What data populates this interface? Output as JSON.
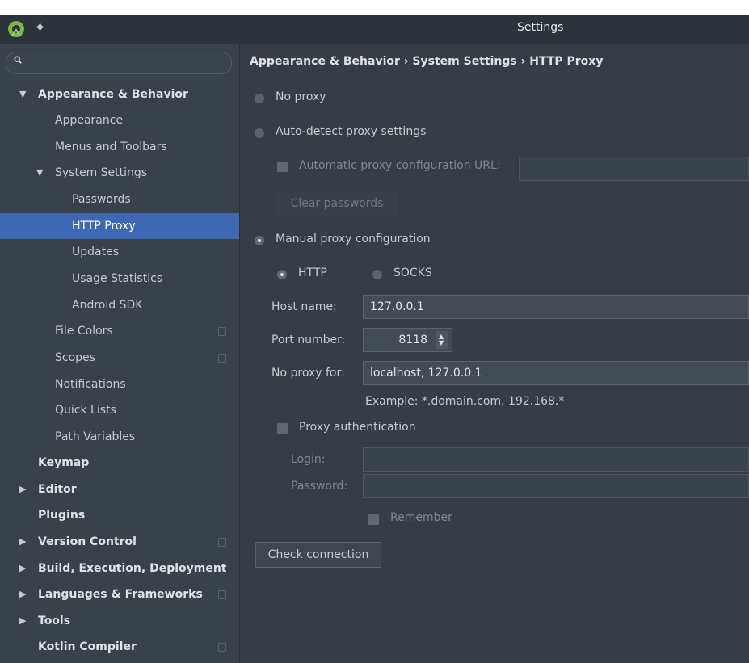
{
  "window": {
    "title": "Settings"
  },
  "search": {
    "placeholder": ""
  },
  "sidebar": {
    "items": [
      {
        "label": "Appearance & Behavior",
        "arrow": "▼"
      },
      {
        "label": "Appearance"
      },
      {
        "label": "Menus and Toolbars"
      },
      {
        "label": "System Settings",
        "arrow": "▼"
      },
      {
        "label": "Passwords"
      },
      {
        "label": "HTTP Proxy"
      },
      {
        "label": "Updates"
      },
      {
        "label": "Usage Statistics"
      },
      {
        "label": "Android SDK"
      },
      {
        "label": "File Colors"
      },
      {
        "label": "Scopes"
      },
      {
        "label": "Notifications"
      },
      {
        "label": "Quick Lists"
      },
      {
        "label": "Path Variables"
      },
      {
        "label": "Keymap"
      },
      {
        "label": "Editor",
        "arrow": "▶"
      },
      {
        "label": "Plugins"
      },
      {
        "label": "Version Control",
        "arrow": "▶"
      },
      {
        "label": "Build, Execution, Deployment",
        "arrow": "▶"
      },
      {
        "label": "Languages & Frameworks",
        "arrow": "▶"
      },
      {
        "label": "Tools",
        "arrow": "▶"
      },
      {
        "label": "Kotlin Compiler"
      }
    ]
  },
  "main": {
    "breadcrumb": "Appearance & Behavior › System Settings › HTTP Proxy",
    "no_proxy_label": "No proxy",
    "auto_detect_label": "Auto-detect proxy settings",
    "auto_config_url_label": "Automatic proxy configuration URL:",
    "auto_config_url_value": "",
    "clear_passwords_label": "Clear passwords",
    "manual_label": "Manual proxy configuration",
    "http_label": "HTTP",
    "socks_label": "SOCKS",
    "host_label": "Host name:",
    "host_value": "127.0.0.1",
    "port_label": "Port number:",
    "port_value": "8118",
    "no_proxy_for_label": "No proxy for:",
    "no_proxy_for_value": "localhost, 127.0.0.1",
    "example_text": "Example: *.domain.com, 192.168.*",
    "proxy_auth_label": "Proxy authentication",
    "login_label": "Login:",
    "login_value": "",
    "password_label": "Password:",
    "password_value": "",
    "remember_label": "Remember",
    "check_connection_label": "Check connection"
  },
  "colors": {
    "background": "#363d46",
    "sidebar": "#39414b",
    "selection": "#3f68b3",
    "text": "#c8ccd1"
  },
  "icons": [
    "android-studio-logo-icon",
    "pin-icon",
    "search-icon",
    "copy-icon",
    "spinner-icon"
  ]
}
